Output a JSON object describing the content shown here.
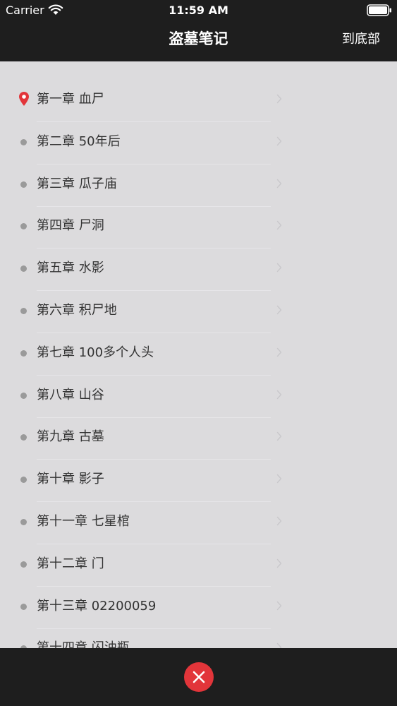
{
  "status_bar": {
    "carrier": "Carrier",
    "time": "11:59 AM"
  },
  "nav": {
    "title": "盗墓笔记",
    "right_action": "到底部"
  },
  "chapters": [
    {
      "label": "第一章 血尸",
      "current": true
    },
    {
      "label": "第二章 50年后",
      "current": false
    },
    {
      "label": "第三章 瓜子庙",
      "current": false
    },
    {
      "label": "第四章 尸洞",
      "current": false
    },
    {
      "label": "第五章 水影",
      "current": false
    },
    {
      "label": "第六章 积尸地",
      "current": false
    },
    {
      "label": "第七章 100多个人头",
      "current": false
    },
    {
      "label": "第八章 山谷",
      "current": false
    },
    {
      "label": "第九章 古墓",
      "current": false
    },
    {
      "label": "第十章 影子",
      "current": false
    },
    {
      "label": "第十一章 七星棺",
      "current": false
    },
    {
      "label": "第十二章 门",
      "current": false
    },
    {
      "label": "第十三章 02200059",
      "current": false
    },
    {
      "label": "第十四章 闪油瓶",
      "current": false
    }
  ],
  "icons": {
    "current_marker": "location-pin-icon",
    "row_bullet": "bullet-dot-icon",
    "row_disclosure": "chevron-right-icon",
    "close": "close-icon"
  },
  "colors": {
    "bar_background": "#1e1e1e",
    "list_background": "#dcdbdd",
    "accent_red": "#e2353a",
    "text": "#333333"
  }
}
